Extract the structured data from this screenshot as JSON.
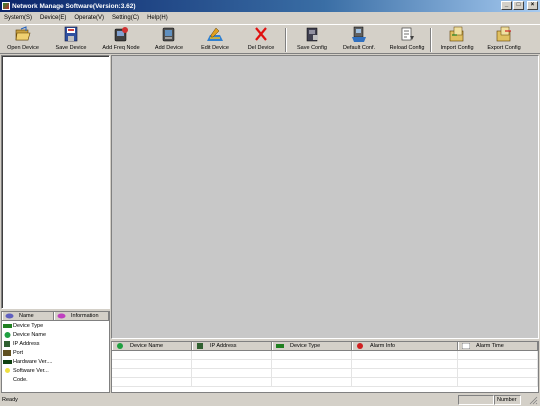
{
  "window": {
    "title": "Network Manage Software(Version:3.62)",
    "controls": [
      "_",
      "□",
      "×"
    ]
  },
  "menu": [
    "System(S)",
    "Device(E)",
    "Operate(V)",
    "Setting(C)",
    "Help(H)"
  ],
  "toolbar": [
    {
      "label": "Open Device",
      "icon": "folder-open-icon"
    },
    {
      "label": "Save Device",
      "icon": "floppy-disk-icon"
    },
    {
      "label": "Add Freq Node",
      "icon": "add-node-icon"
    },
    {
      "label": "Add Device",
      "icon": "add-device-icon"
    },
    {
      "label": "Edit Device",
      "icon": "edit-device-icon"
    },
    {
      "label": "Del Device",
      "icon": "delete-x-icon"
    },
    {
      "label": "Save Config",
      "icon": "save-config-icon"
    },
    {
      "label": "Default Conf.",
      "icon": "default-config-icon"
    },
    {
      "label": "Reload Config",
      "icon": "reload-config-icon"
    },
    {
      "label": "Import Config",
      "icon": "import-config-icon"
    },
    {
      "label": "Export Config",
      "icon": "export-config-icon"
    }
  ],
  "info_panel": {
    "headers": [
      "Name",
      "Information"
    ],
    "rows": [
      {
        "name": "Device Type",
        "icon": "device-type-icon"
      },
      {
        "name": "Device Name",
        "icon": "device-name-icon"
      },
      {
        "name": "IP Address",
        "icon": "ip-address-icon"
      },
      {
        "name": "Port",
        "icon": "port-icon"
      },
      {
        "name": "Hardware Ver....",
        "icon": "hardware-icon"
      },
      {
        "name": "Software Ver...",
        "icon": "bulb-icon"
      },
      {
        "name": "Code.",
        "icon": ""
      }
    ]
  },
  "device_list": {
    "columns": [
      "Device Name",
      "IP Address",
      "Device Type",
      "Alarm Info",
      "Alarm Time"
    ]
  },
  "status": {
    "text": "Ready",
    "number_label": "Number"
  },
  "colors": {
    "titlebar_start": "#0a246a",
    "titlebar_end": "#a6caf0",
    "chrome": "#d4d0c8",
    "workspace": "#c8c8c8"
  }
}
